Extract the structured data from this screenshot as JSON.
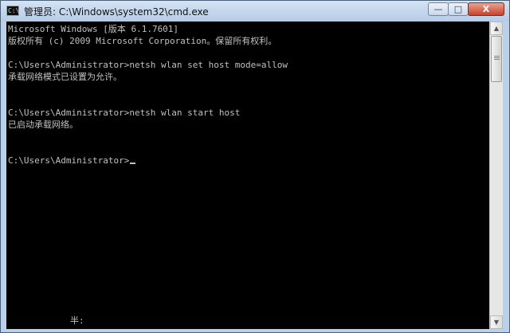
{
  "window": {
    "title": "管理员: C:\\Windows\\system32\\cmd.exe",
    "icon": "cmd-icon",
    "controls": {
      "minimize": "—",
      "maximize": "□",
      "close": "X"
    }
  },
  "console": {
    "lines": [
      "Microsoft Windows [版本 6.1.7601]",
      "版权所有 (c) 2009 Microsoft Corporation。保留所有权利。",
      "",
      "C:\\Users\\Administrator>netsh wlan set host mode=allow",
      "承载网络模式已设置为允许。",
      "",
      "",
      "C:\\Users\\Administrator>netsh wlan start host",
      "已启动承载网络。",
      "",
      "",
      "C:\\Users\\Administrator>"
    ],
    "ime_status": "半:"
  },
  "colors": {
    "console_bg": "#000000",
    "console_text": "#c0c0c0",
    "titlebar": "#c6d9ef",
    "close_button": "#c7412b"
  }
}
